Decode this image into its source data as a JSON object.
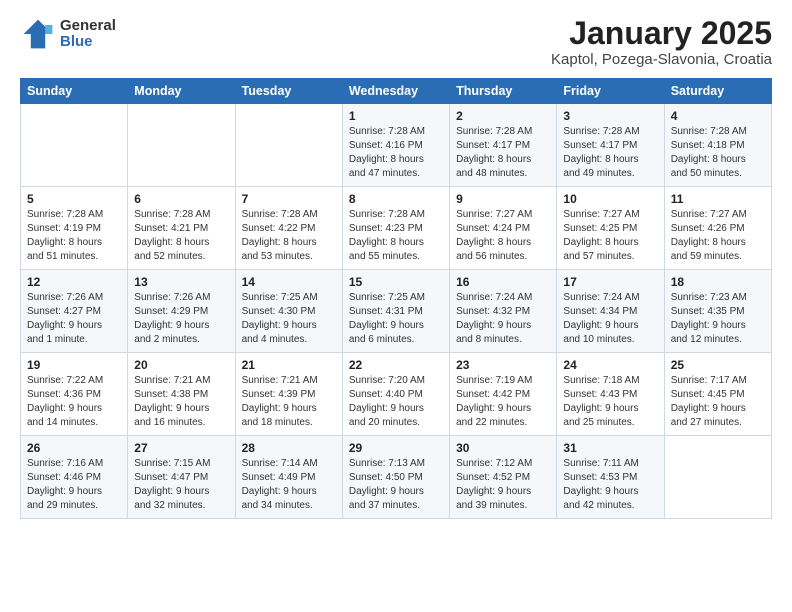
{
  "header": {
    "logo_general": "General",
    "logo_blue": "Blue",
    "title": "January 2025",
    "subtitle": "Kaptol, Pozega-Slavonia, Croatia"
  },
  "days_of_week": [
    "Sunday",
    "Monday",
    "Tuesday",
    "Wednesday",
    "Thursday",
    "Friday",
    "Saturday"
  ],
  "weeks": [
    [
      null,
      null,
      null,
      {
        "day": 1,
        "sunrise": "7:28 AM",
        "sunset": "4:16 PM",
        "daylight": "8 hours and 47 minutes."
      },
      {
        "day": 2,
        "sunrise": "7:28 AM",
        "sunset": "4:17 PM",
        "daylight": "8 hours and 48 minutes."
      },
      {
        "day": 3,
        "sunrise": "7:28 AM",
        "sunset": "4:17 PM",
        "daylight": "8 hours and 49 minutes."
      },
      {
        "day": 4,
        "sunrise": "7:28 AM",
        "sunset": "4:18 PM",
        "daylight": "8 hours and 50 minutes."
      }
    ],
    [
      {
        "day": 5,
        "sunrise": "7:28 AM",
        "sunset": "4:19 PM",
        "daylight": "8 hours and 51 minutes."
      },
      {
        "day": 6,
        "sunrise": "7:28 AM",
        "sunset": "4:21 PM",
        "daylight": "8 hours and 52 minutes."
      },
      {
        "day": 7,
        "sunrise": "7:28 AM",
        "sunset": "4:22 PM",
        "daylight": "8 hours and 53 minutes."
      },
      {
        "day": 8,
        "sunrise": "7:28 AM",
        "sunset": "4:23 PM",
        "daylight": "8 hours and 55 minutes."
      },
      {
        "day": 9,
        "sunrise": "7:27 AM",
        "sunset": "4:24 PM",
        "daylight": "8 hours and 56 minutes."
      },
      {
        "day": 10,
        "sunrise": "7:27 AM",
        "sunset": "4:25 PM",
        "daylight": "8 hours and 57 minutes."
      },
      {
        "day": 11,
        "sunrise": "7:27 AM",
        "sunset": "4:26 PM",
        "daylight": "8 hours and 59 minutes."
      }
    ],
    [
      {
        "day": 12,
        "sunrise": "7:26 AM",
        "sunset": "4:27 PM",
        "daylight": "9 hours and 1 minute."
      },
      {
        "day": 13,
        "sunrise": "7:26 AM",
        "sunset": "4:29 PM",
        "daylight": "9 hours and 2 minutes."
      },
      {
        "day": 14,
        "sunrise": "7:25 AM",
        "sunset": "4:30 PM",
        "daylight": "9 hours and 4 minutes."
      },
      {
        "day": 15,
        "sunrise": "7:25 AM",
        "sunset": "4:31 PM",
        "daylight": "9 hours and 6 minutes."
      },
      {
        "day": 16,
        "sunrise": "7:24 AM",
        "sunset": "4:32 PM",
        "daylight": "9 hours and 8 minutes."
      },
      {
        "day": 17,
        "sunrise": "7:24 AM",
        "sunset": "4:34 PM",
        "daylight": "9 hours and 10 minutes."
      },
      {
        "day": 18,
        "sunrise": "7:23 AM",
        "sunset": "4:35 PM",
        "daylight": "9 hours and 12 minutes."
      }
    ],
    [
      {
        "day": 19,
        "sunrise": "7:22 AM",
        "sunset": "4:36 PM",
        "daylight": "9 hours and 14 minutes."
      },
      {
        "day": 20,
        "sunrise": "7:21 AM",
        "sunset": "4:38 PM",
        "daylight": "9 hours and 16 minutes."
      },
      {
        "day": 21,
        "sunrise": "7:21 AM",
        "sunset": "4:39 PM",
        "daylight": "9 hours and 18 minutes."
      },
      {
        "day": 22,
        "sunrise": "7:20 AM",
        "sunset": "4:40 PM",
        "daylight": "9 hours and 20 minutes."
      },
      {
        "day": 23,
        "sunrise": "7:19 AM",
        "sunset": "4:42 PM",
        "daylight": "9 hours and 22 minutes."
      },
      {
        "day": 24,
        "sunrise": "7:18 AM",
        "sunset": "4:43 PM",
        "daylight": "9 hours and 25 minutes."
      },
      {
        "day": 25,
        "sunrise": "7:17 AM",
        "sunset": "4:45 PM",
        "daylight": "9 hours and 27 minutes."
      }
    ],
    [
      {
        "day": 26,
        "sunrise": "7:16 AM",
        "sunset": "4:46 PM",
        "daylight": "9 hours and 29 minutes."
      },
      {
        "day": 27,
        "sunrise": "7:15 AM",
        "sunset": "4:47 PM",
        "daylight": "9 hours and 32 minutes."
      },
      {
        "day": 28,
        "sunrise": "7:14 AM",
        "sunset": "4:49 PM",
        "daylight": "9 hours and 34 minutes."
      },
      {
        "day": 29,
        "sunrise": "7:13 AM",
        "sunset": "4:50 PM",
        "daylight": "9 hours and 37 minutes."
      },
      {
        "day": 30,
        "sunrise": "7:12 AM",
        "sunset": "4:52 PM",
        "daylight": "9 hours and 39 minutes."
      },
      {
        "day": 31,
        "sunrise": "7:11 AM",
        "sunset": "4:53 PM",
        "daylight": "9 hours and 42 minutes."
      },
      null
    ]
  ],
  "labels": {
    "sunrise": "Sunrise:",
    "sunset": "Sunset:",
    "daylight": "Daylight:"
  }
}
